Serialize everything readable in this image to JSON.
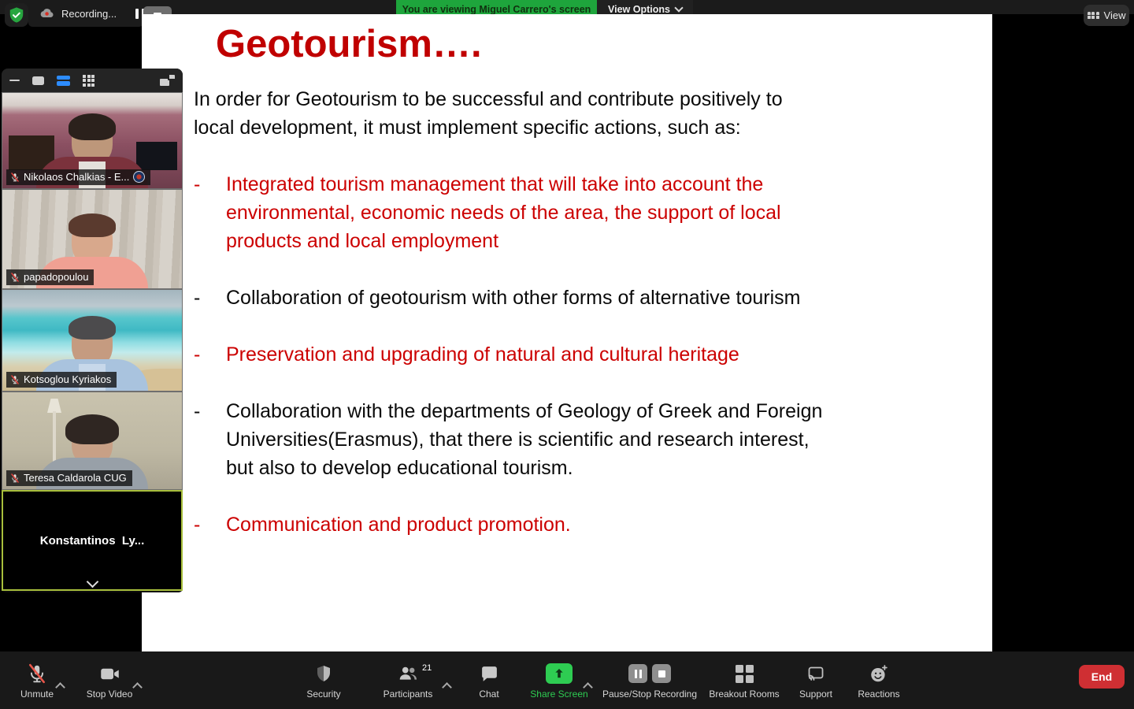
{
  "meeting": {
    "recording_label": "Recording...",
    "banner": "You are viewing Miguel Carrero's screen",
    "view_options_label": "View Options",
    "view_label": "View"
  },
  "participants_panel": {
    "participants": [
      {
        "name": "Nikolaos Chalkias - E...",
        "muted": true,
        "video": true,
        "has_logo_badge": true
      },
      {
        "name": "papadopoulou",
        "muted": true,
        "video": true,
        "has_logo_badge": false
      },
      {
        "name": "Kotsoglou Kyriakos",
        "muted": true,
        "video": true,
        "has_logo_badge": false
      },
      {
        "name": "Teresa Caldarola CUG",
        "muted": true,
        "video": true,
        "has_logo_badge": false
      },
      {
        "name": "Konstantinos  Ly...",
        "muted": false,
        "video": false,
        "active_speaker": true
      }
    ]
  },
  "slide": {
    "title": "Geotourism….",
    "intro": "In order for Geotourism to be successful and contribute positively to\nlocal development, it must implement specific actions, such as:",
    "bullet_marker": "-",
    "bullets": [
      {
        "text": "Integrated tourism management that will take into account the\nenvironmental, economic needs of the area, the support of local\nproducts and local employment",
        "color": "red"
      },
      {
        "text": "Collaboration of geotourism with other forms of alternative tourism",
        "color": "black"
      },
      {
        "text": "Preservation and upgrading of natural and cultural heritage",
        "color": "red"
      },
      {
        "text": "Collaboration with the departments of Geology of Greek and Foreign\nUniversities(Erasmus), that there is scientific and research interest,\nbut also to develop educational tourism.",
        "color": "black"
      },
      {
        "text": "Communication and product promotion.",
        "color": "red"
      }
    ]
  },
  "toolbar": {
    "unmute": "Unmute",
    "stop_video": "Stop Video",
    "security": "Security",
    "participants": "Participants",
    "participants_count": "21",
    "chat": "Chat",
    "share_screen": "Share Screen",
    "pause_stop_recording": "Pause/Stop Recording",
    "breakout_rooms": "Breakout Rooms",
    "support": "Support",
    "reactions": "Reactions",
    "end": "End"
  },
  "colors": {
    "banner_green": "#1ea53c",
    "share_green": "#2ecc52",
    "end_red": "#cf2f33",
    "slide_title_red": "#c00000",
    "slide_bullet_red": "#cc0000",
    "active_speaker_border": "#a8bf3c",
    "view_accent_blue": "#2d8cff"
  }
}
